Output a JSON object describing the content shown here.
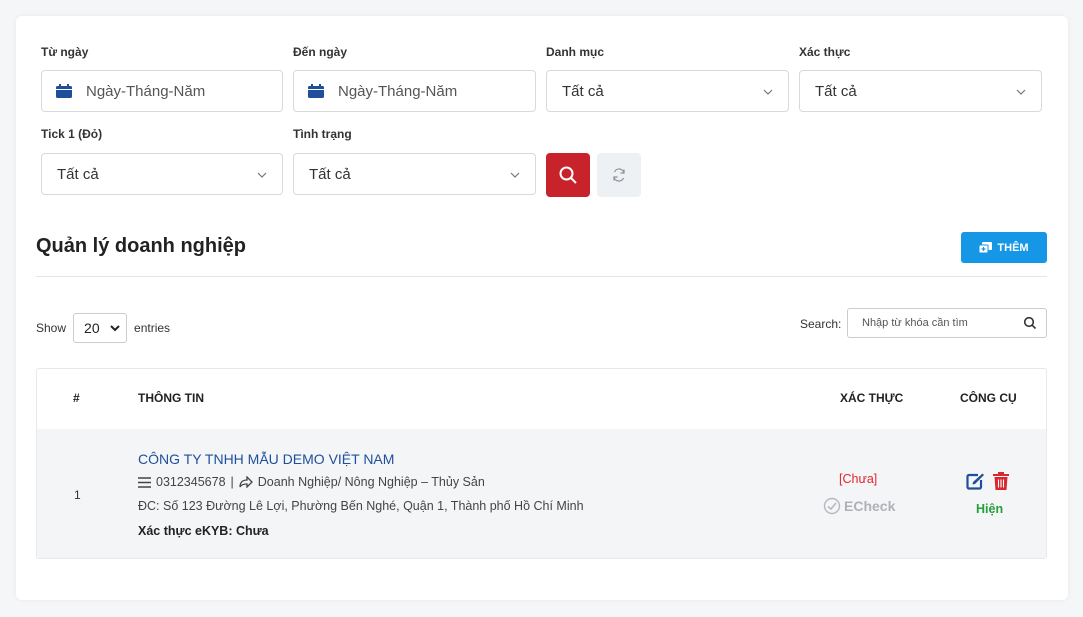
{
  "filters": {
    "from_date": {
      "label": "Từ ngày",
      "placeholder": "Ngày-Tháng-Năm"
    },
    "to_date": {
      "label": "Đến ngày",
      "placeholder": "Ngày-Tháng-Năm"
    },
    "category": {
      "label": "Danh mục",
      "value": "Tất cả"
    },
    "verify": {
      "label": "Xác thực",
      "value": "Tất cả"
    },
    "tick1": {
      "label": "Tick 1 (Đỏ)",
      "value": "Tất cả"
    },
    "status": {
      "label": "Tình trạng",
      "value": "Tất cả"
    },
    "search_icon": "search-icon",
    "reset_icon": "refresh-icon"
  },
  "colors": {
    "search_button": "#c8222a",
    "add_button": "#1597e5",
    "company_link": "#1f4f9a",
    "unverified": "#e0262e",
    "visible": "#23a03a"
  },
  "page": {
    "title": "Quản lý doanh nghiệp",
    "add_label": "THÊM"
  },
  "table_controls": {
    "show_label": "Show",
    "entries_value": "20",
    "entries_label": "entries",
    "search_label": "Search:",
    "search_placeholder": "Nhập từ khóa cần tìm"
  },
  "table": {
    "headers": [
      "#",
      "THÔNG TIN",
      "XÁC THỰC",
      "CÔNG CỤ"
    ],
    "rows": [
      {
        "index": "1",
        "company": "CÔNG TY TNHH MẪU DEMO VIỆT NAM",
        "tax_code": "0312345678",
        "separator": "|",
        "industry": "Doanh Nghiệp/ Nông Nghiệp – Thủy Sản",
        "address": "ĐC: Số 123 Đường Lê Lợi, Phường Bến Nghé, Quận 1, Thành phố Hồ Chí Minh",
        "ekyb": "Xác thực eKYB: Chưa",
        "verify_status": "[Chưa]",
        "echeck": "ECheck",
        "visibility": "Hiện"
      }
    ]
  }
}
